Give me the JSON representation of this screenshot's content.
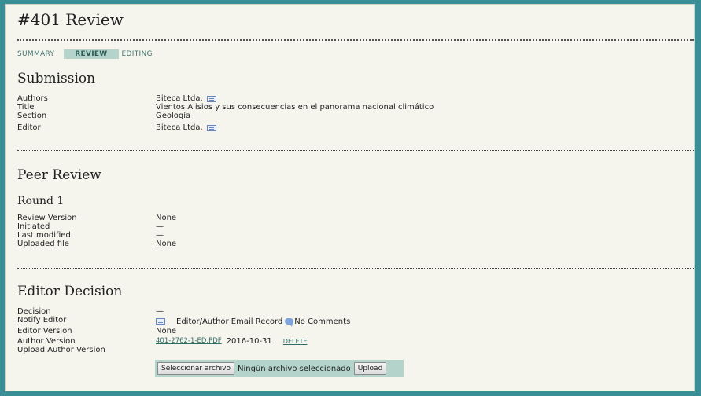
{
  "page": {
    "title": "#401 Review"
  },
  "tabs": [
    {
      "label": "SUMMARY",
      "active": false
    },
    {
      "label": "REVIEW",
      "active": true
    },
    {
      "label": "EDITING",
      "active": false
    }
  ],
  "submission": {
    "heading": "Submission",
    "authors_label": "Authors",
    "authors_value": "Biteca Ltda.",
    "title_label": "Title",
    "title_value": "Vientos Alisios y sus consecuencias en el panorama nacional climático",
    "section_label": "Section",
    "section_value": "Geología",
    "editor_label": "Editor",
    "editor_value": "Biteca Ltda."
  },
  "peer_review": {
    "heading": "Peer Review",
    "round_heading": "Round 1",
    "review_version_label": "Review Version",
    "review_version_value": "None",
    "initiated_label": "Initiated",
    "initiated_value": "—",
    "last_modified_label": "Last modified",
    "last_modified_value": "—",
    "uploaded_file_label": "Uploaded file",
    "uploaded_file_value": "None"
  },
  "editor_decision": {
    "heading": "Editor Decision",
    "decision_label": "Decision",
    "decision_value": "—",
    "notify_label": "Notify Editor",
    "email_record_text": "Editor/Author Email Record",
    "comments_text": "No Comments",
    "editor_version_label": "Editor Version",
    "editor_version_value": "None",
    "author_version_label": "Author Version",
    "author_file_link": "401-2762-1-ED.PDF",
    "author_file_date": "2016-10-31",
    "delete_label": "DELETE",
    "upload_label": "Upload Author Version",
    "choose_file_button": "Seleccionar archivo",
    "no_file_text": "Ningún archivo seleccionado",
    "upload_button": "Upload"
  },
  "icons": {
    "email": "envelope-icon",
    "comment": "comment-icon"
  },
  "colors": {
    "background_teal": "#3a8f96",
    "active_tab": "#b3d3cb",
    "link": "#2f6b66"
  }
}
